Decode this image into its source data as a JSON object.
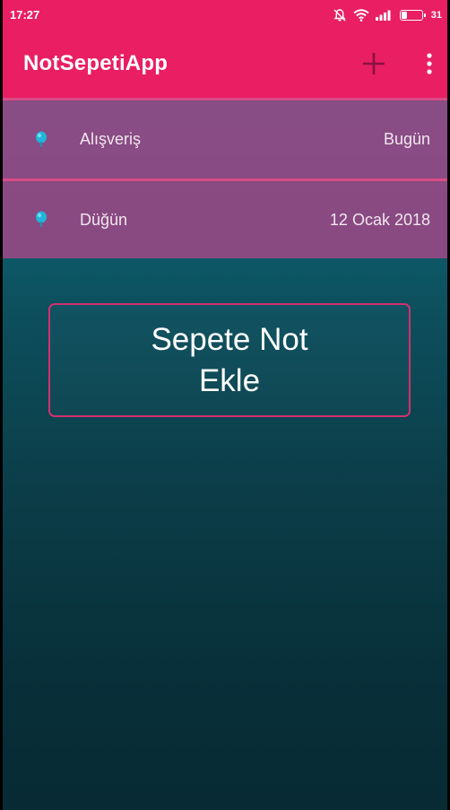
{
  "status": {
    "time": "17:27",
    "battery_level": "31"
  },
  "toolbar": {
    "title": "NotSepetiApp",
    "add_icon": "plus-icon",
    "menu_icon": "more-vert-icon"
  },
  "notes": [
    {
      "title": "Alışveriş",
      "date": "Bugün",
      "icon": "pin-icon"
    },
    {
      "title": "Düğün",
      "date": "12 Ocak 2018",
      "icon": "pin-icon"
    }
  ],
  "add_note_button": {
    "label": "Sepete Not Ekle"
  },
  "colors": {
    "accent": "#e91e63",
    "list_item": "#974884",
    "pin": "#22b6d8",
    "background_top": "#0a7e93",
    "background_bottom": "#072a33"
  }
}
